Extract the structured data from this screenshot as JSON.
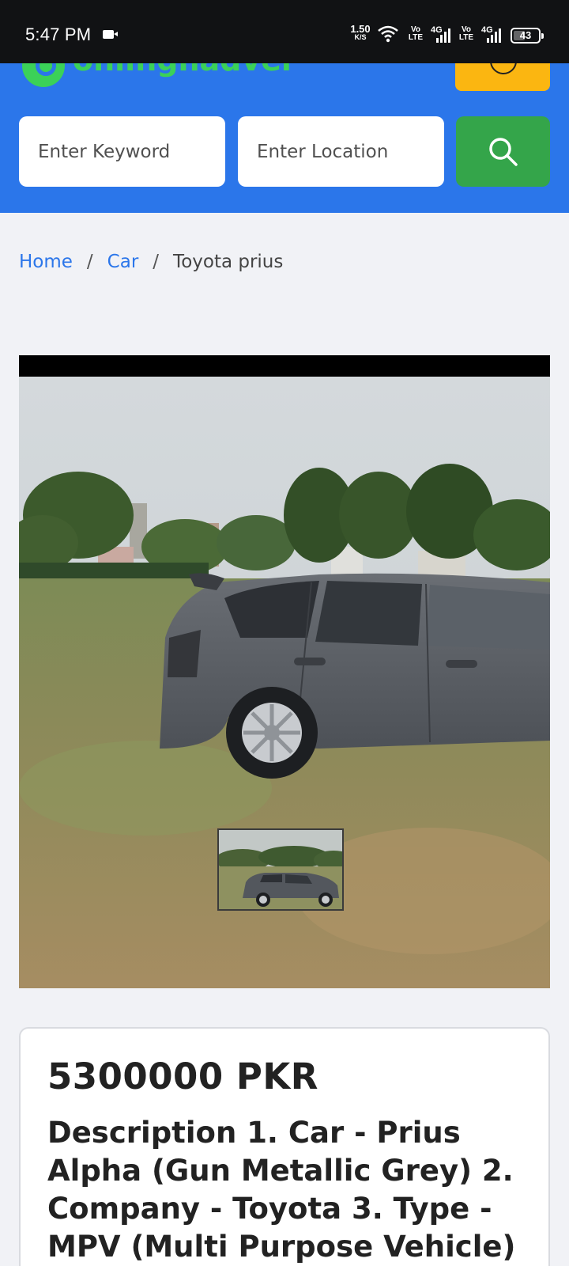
{
  "status_bar": {
    "time": "5:47 PM",
    "net_speed_value": "1.50",
    "net_speed_unit": "K/S",
    "volte_1": "Vo\nLTE",
    "net_type_1": "4G",
    "volte_2": "Vo\nLTE",
    "net_type_2": "4G",
    "battery_level": "43"
  },
  "header": {
    "logo_text": "onlinghadverts",
    "search": {
      "keyword_placeholder": "Enter Keyword",
      "location_placeholder": "Enter Location"
    },
    "colors": {
      "bar": "#2b76ea",
      "search_button": "#34a54a",
      "menu_button": "#fbb611",
      "logo": "#3bd158"
    }
  },
  "breadcrumb": {
    "home": "Home",
    "separator": "/",
    "category": "Car",
    "current": "Toyota prius"
  },
  "listing": {
    "price": "5300000 PKR",
    "description": "Description 1. Car - Prius Alpha (Gun Metallic Grey) 2. Company - Toyota 3. Type - MPV (Multi Purpose Vehicle)"
  },
  "icons": {
    "search_button": "search-icon",
    "status_record": "video-record-icon",
    "wifi": "wifi-icon",
    "signal": "signal-icon",
    "battery": "battery-icon"
  }
}
